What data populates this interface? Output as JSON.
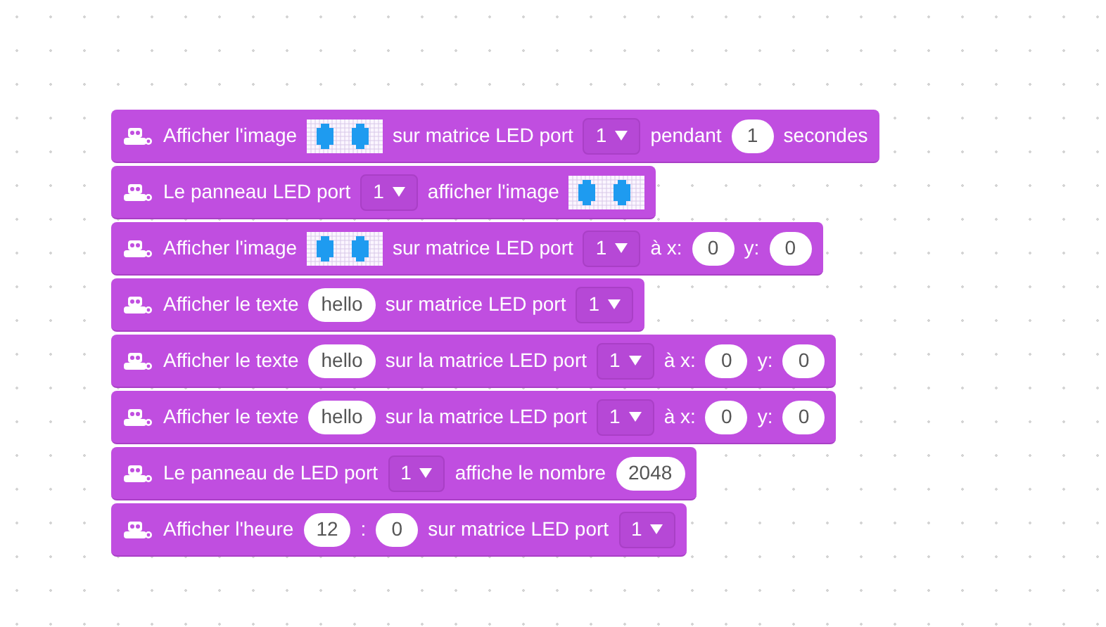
{
  "blocks": [
    {
      "segments": [
        {
          "kind": "text",
          "text": "Afficher l'image"
        },
        {
          "kind": "led-image"
        },
        {
          "kind": "text",
          "text": "sur matrice LED port"
        },
        {
          "kind": "dropdown",
          "text": "1"
        },
        {
          "kind": "text",
          "text": "pendant"
        },
        {
          "kind": "number",
          "text": "1"
        },
        {
          "kind": "text",
          "text": "secondes"
        }
      ]
    },
    {
      "segments": [
        {
          "kind": "text",
          "text": "Le panneau LED port"
        },
        {
          "kind": "dropdown",
          "text": "1"
        },
        {
          "kind": "text",
          "text": "afficher l'image"
        },
        {
          "kind": "led-image"
        }
      ]
    },
    {
      "segments": [
        {
          "kind": "text",
          "text": "Afficher l'image"
        },
        {
          "kind": "led-image"
        },
        {
          "kind": "text",
          "text": "sur matrice LED port"
        },
        {
          "kind": "dropdown",
          "text": "1"
        },
        {
          "kind": "text",
          "text": "à x:"
        },
        {
          "kind": "number",
          "text": "0"
        },
        {
          "kind": "text",
          "text": "y:"
        },
        {
          "kind": "number",
          "text": "0"
        }
      ]
    },
    {
      "segments": [
        {
          "kind": "text",
          "text": "Afficher le texte"
        },
        {
          "kind": "number",
          "text": "hello"
        },
        {
          "kind": "text",
          "text": "sur matrice LED port"
        },
        {
          "kind": "dropdown",
          "text": "1"
        }
      ]
    },
    {
      "segments": [
        {
          "kind": "text",
          "text": "Afficher le texte"
        },
        {
          "kind": "number",
          "text": "hello"
        },
        {
          "kind": "text",
          "text": "sur la matrice LED port"
        },
        {
          "kind": "dropdown",
          "text": "1"
        },
        {
          "kind": "text",
          "text": "à x:"
        },
        {
          "kind": "number",
          "text": "0"
        },
        {
          "kind": "text",
          "text": "y:"
        },
        {
          "kind": "number",
          "text": "0"
        }
      ]
    },
    {
      "segments": [
        {
          "kind": "text",
          "text": "Afficher le texte"
        },
        {
          "kind": "number",
          "text": "hello"
        },
        {
          "kind": "text",
          "text": "sur la matrice LED port"
        },
        {
          "kind": "dropdown",
          "text": "1"
        },
        {
          "kind": "text",
          "text": "à x:"
        },
        {
          "kind": "number",
          "text": "0"
        },
        {
          "kind": "text",
          "text": "y:"
        },
        {
          "kind": "number",
          "text": "0"
        }
      ]
    },
    {
      "segments": [
        {
          "kind": "text",
          "text": "Le panneau de LED port"
        },
        {
          "kind": "dropdown",
          "text": "1"
        },
        {
          "kind": "text",
          "text": "affiche le nombre"
        },
        {
          "kind": "number",
          "text": "2048"
        }
      ]
    },
    {
      "segments": [
        {
          "kind": "text",
          "text": "Afficher l'heure"
        },
        {
          "kind": "number",
          "text": "12"
        },
        {
          "kind": "text",
          "text": ":"
        },
        {
          "kind": "number",
          "text": "0"
        },
        {
          "kind": "text",
          "text": "sur matrice LED port"
        },
        {
          "kind": "dropdown",
          "text": "1"
        }
      ]
    }
  ]
}
